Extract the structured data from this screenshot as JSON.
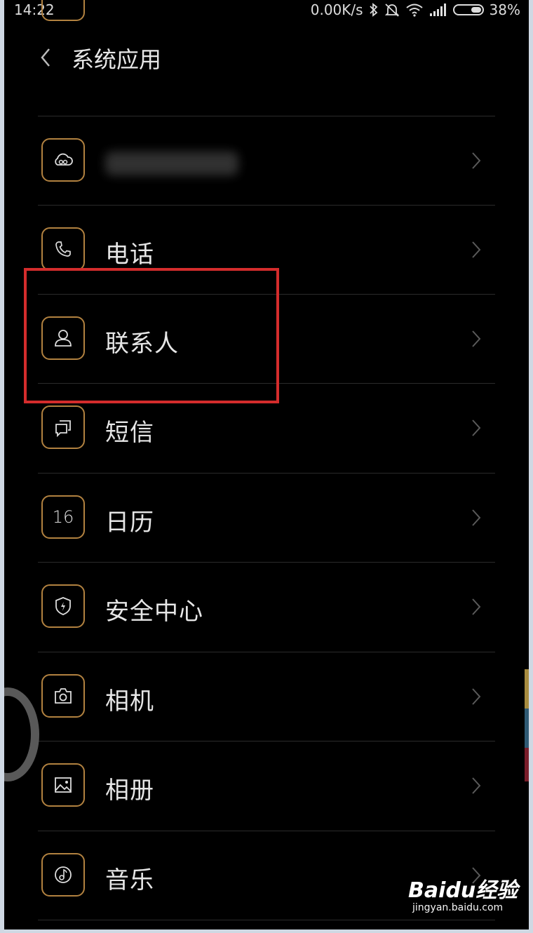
{
  "status_bar": {
    "time": "14:22",
    "network_speed": "0.00K/s",
    "battery_percent": "38%",
    "battery_level": 0.38,
    "icons": [
      "bluetooth-icon",
      "mute-icon",
      "wifi-icon",
      "signal-icon",
      "battery-icon"
    ]
  },
  "header": {
    "title": "系统应用"
  },
  "items": [
    {
      "label": "",
      "icon": "cloud-icon"
    },
    {
      "label": "电话",
      "icon": "phone-icon"
    },
    {
      "label": "联系人",
      "icon": "contact-icon"
    },
    {
      "label": "短信",
      "icon": "message-icon"
    },
    {
      "label": "日历",
      "icon": "calendar-icon",
      "icon_text": "16"
    },
    {
      "label": "安全中心",
      "icon": "shield-icon"
    },
    {
      "label": "相机",
      "icon": "camera-icon"
    },
    {
      "label": "相册",
      "icon": "gallery-icon"
    },
    {
      "label": "音乐",
      "icon": "music-icon"
    }
  ],
  "watermark": {
    "brand": "Baidu经验",
    "url": "jingyan.baidu.com"
  },
  "colors": {
    "background": "#000000",
    "icon_border": "#b28240",
    "highlight": "#d42c2c",
    "text": "#e6e6e6"
  }
}
